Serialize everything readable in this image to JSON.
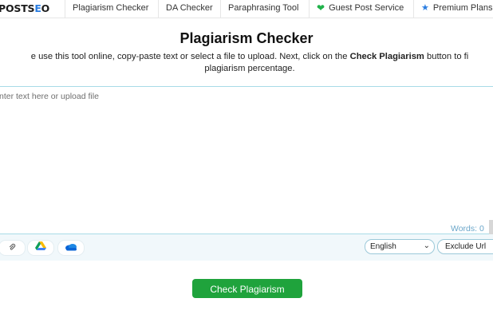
{
  "nav": {
    "logo_main": "POSTS",
    "logo_accent": "E",
    "logo_end": "O",
    "items": [
      {
        "label": "Plagiarism Checker"
      },
      {
        "label": "DA Checker"
      },
      {
        "label": "Paraphrasing Tool"
      },
      {
        "label": "Guest Post Service",
        "icon": "heart-icon",
        "icon_color": "#20b24a"
      },
      {
        "label": "Premium Plans",
        "icon": "star-icon",
        "icon_color": "#2a7de1"
      }
    ]
  },
  "main": {
    "title": "Plagiarism Checker",
    "desc_part1": "e use this tool online, copy-paste text or select a file to upload. Next, click on the ",
    "desc_bold": "Check Plagiarism",
    "desc_part2": " button to fi",
    "desc_line2": "plagiarism percentage."
  },
  "editor": {
    "placeholder": "nter text here or upload file",
    "value": "",
    "word_count": "Words: 0"
  },
  "toolbar": {
    "tools": [
      "attach-icon",
      "google-drive-icon",
      "onedrive-icon"
    ],
    "language_selected": "English",
    "exclude_label": "Exclude Url"
  },
  "actions": {
    "check_label": "Check Plagiarism"
  },
  "colors": {
    "primary_green": "#1fa33c",
    "accent_blue": "#2a7de1",
    "border_teal": "#a8dbe7"
  }
}
